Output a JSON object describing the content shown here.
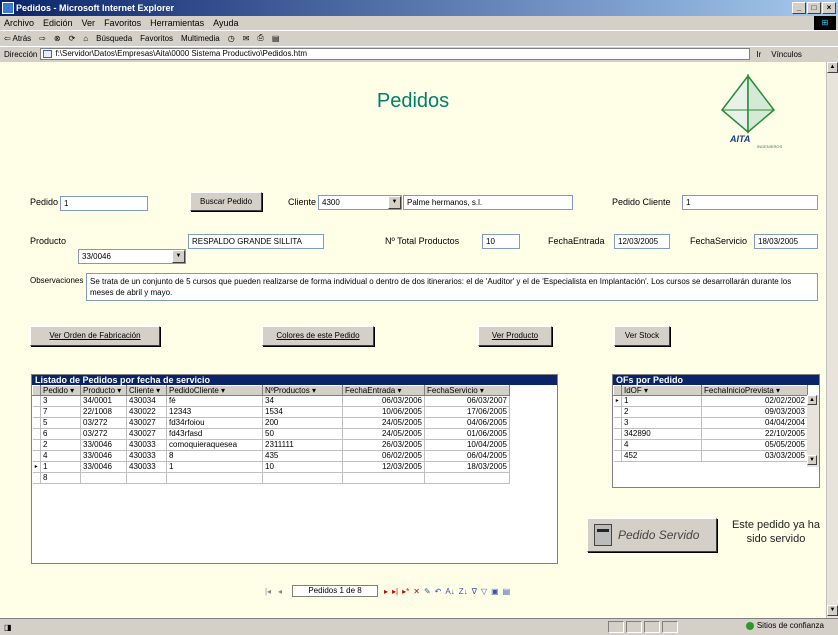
{
  "window": {
    "title": "Pedidos - Microsoft Internet Explorer",
    "controls": [
      "_",
      "□",
      "×"
    ]
  },
  "menu": [
    "Archivo",
    "Edición",
    "Ver",
    "Favoritos",
    "Herramientas",
    "Ayuda"
  ],
  "toolbar": [
    "⇦ Atrás",
    "⇨",
    "⊗",
    "⟳",
    "⌂",
    "Búsqueda",
    "Favoritos",
    "Multimedia",
    "◷",
    "✉",
    "⎙",
    "▤"
  ],
  "address": {
    "label": "Dirección",
    "url": "f:\\Servidor\\Datos\\Empresas\\Aita\\0000 Sistema Productivo\\Pedidos.htm",
    "go": "Ir",
    "links": "Vínculos"
  },
  "form": {
    "title": "Pedidos",
    "logo_text": "AITA",
    "logo_sub": "INGENIEROS",
    "pedido_label": "Pedido",
    "pedido_value": "1",
    "buscar_button": "Buscar Pedido",
    "cliente_label": "Cliente",
    "cliente_code": "4300",
    "cliente_name": "Palme hermanos, s.l.",
    "pedido_cliente_label": "Pedido Cliente",
    "pedido_cliente_value": "1",
    "producto_label": "Producto",
    "producto_code": "33/0046",
    "producto_name": "RESPALDO GRANDE SILLITA",
    "total_productos_label": "Nº Total Productos",
    "total_productos_value": "10",
    "fecha_entrada_label": "FechaEntrada",
    "fecha_entrada_value": "12/03/2005",
    "fecha_servicio_label": "FechaServicio",
    "fecha_servicio_value": "18/03/2005",
    "observaciones_label": "Observaciones",
    "observaciones_value": "Se trata de un conjunto de 5 cursos que pueden realizarse de forma individual o dentro de dos itinerarios: el de 'Auditor' y el de 'Especialista en Implantación'. Los cursos se desarrollarán durante los meses de abril y mayo.",
    "btn_orden": "Ver Orden de Fabricación",
    "btn_colores": "Colores de este Pedido",
    "btn_producto": "Ver Producto",
    "btn_stock": "Ver Stock",
    "servido_button": "Pedido Servido",
    "servido_message": "Este pedido ya ha sido servido"
  },
  "orders_grid": {
    "caption": "Listado de Pedidos por fecha de servicio",
    "columns": [
      "Pedido ▾",
      "Producto ▾",
      "Cliente ▾",
      "PedidoCliente ▾",
      "NºProductos ▾",
      "FechaEntrada ▾",
      "FechaServicio ▾"
    ],
    "rows": [
      {
        "sel": "",
        "c": [
          "3",
          "34/0001",
          "430034",
          "fé",
          "34",
          "06/03/2006",
          "06/03/2007"
        ]
      },
      {
        "sel": "",
        "c": [
          "7",
          "22/1008",
          "430022",
          "12343",
          "1534",
          "10/06/2005",
          "17/06/2005"
        ]
      },
      {
        "sel": "",
        "c": [
          "5",
          "03/272",
          "430027",
          "fd34rfoiou",
          "200",
          "24/05/2005",
          "04/06/2005"
        ]
      },
      {
        "sel": "",
        "c": [
          "6",
          "03/272",
          "430027",
          "fd43rfasd",
          "50",
          "24/05/2005",
          "01/06/2005"
        ]
      },
      {
        "sel": "",
        "c": [
          "2",
          "33/0046",
          "430033",
          "comoquieraquesea",
          "2311111",
          "26/03/2005",
          "10/04/2005"
        ]
      },
      {
        "sel": "",
        "c": [
          "4",
          "33/0046",
          "430033",
          "8",
          "435",
          "06/02/2005",
          "06/04/2005"
        ]
      },
      {
        "sel": "▸",
        "c": [
          "1",
          "33/0046",
          "430033",
          "1",
          "10",
          "12/03/2005",
          "18/03/2005"
        ]
      },
      {
        "sel": "",
        "c": [
          "8",
          "",
          "",
          "",
          "",
          "",
          ""
        ]
      }
    ]
  },
  "of_grid": {
    "caption": "OFs por Pedido",
    "columns": [
      "IdOF ▾",
      "FechaInicioPrevista ▾"
    ],
    "rows": [
      {
        "sel": "▸",
        "c": [
          "1",
          "02/02/2002"
        ]
      },
      {
        "sel": "",
        "c": [
          "2",
          "09/03/2003"
        ]
      },
      {
        "sel": "",
        "c": [
          "3",
          "04/04/2004"
        ]
      },
      {
        "sel": "",
        "c": [
          "342890",
          "22/10/2005"
        ]
      },
      {
        "sel": "",
        "c": [
          "4",
          "05/05/2005"
        ]
      },
      {
        "sel": "",
        "c": [
          "452",
          "03/03/2005"
        ]
      }
    ]
  },
  "navigator": {
    "record_text": "Pedidos 1 de 8"
  },
  "status": {
    "zone": "Sitios de confianza"
  },
  "colors": {
    "accent": "#00806a",
    "grid_caption": "#0a246a",
    "form_bg": "#ffffe8"
  }
}
